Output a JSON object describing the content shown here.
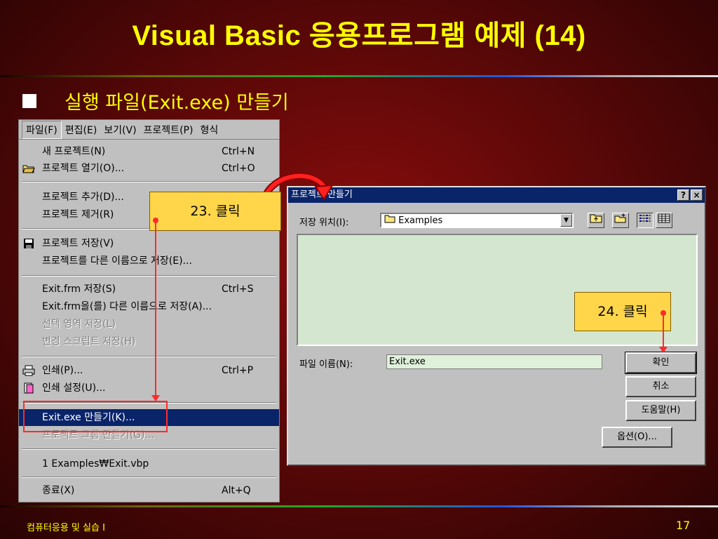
{
  "slide": {
    "title": "Visual  Basic 응용프로그램 예제 (14)",
    "bullet": "실행 파일(Exit.exe) 만들기",
    "footer_left": "컴퓨터응용 및 실습 Ⅰ",
    "page_number": "17"
  },
  "menubar": {
    "items": [
      "파일(F)",
      "편집(E)",
      "보기(V)",
      "프로젝트(P)",
      "형식"
    ]
  },
  "menu": {
    "items": [
      {
        "label": "새 프로젝트(N)",
        "shortcut": "Ctrl+N"
      },
      {
        "label": "프로젝트 열기(O)...",
        "shortcut": "Ctrl+O",
        "icon": "open-folder-icon"
      },
      {
        "label": "프로젝트 추가(D)...",
        "shortcut": ""
      },
      {
        "label": "프로젝트 제거(R)",
        "shortcut": ""
      },
      {
        "label": "프로젝트 저장(V)",
        "shortcut": "",
        "icon": "save-disk-icon"
      },
      {
        "label": "프로젝트를 다른 이름으로 저장(E)...",
        "shortcut": ""
      },
      {
        "label": "Exit.frm 저장(S)",
        "shortcut": "Ctrl+S"
      },
      {
        "label": "Exit.frm을(를) 다른 이름으로 저장(A)...",
        "shortcut": ""
      },
      {
        "label": "선택 영역 저장(L)",
        "shortcut": "",
        "disabled": true
      },
      {
        "label": "변경 스크립트 저장(H)",
        "shortcut": "",
        "disabled": true
      },
      {
        "label": "인쇄(P)...",
        "shortcut": "Ctrl+P",
        "icon": "printer-icon"
      },
      {
        "label": "인쇄 설정(U)...",
        "shortcut": "",
        "icon": "page-setup-icon"
      },
      {
        "label": "Exit.exe 만들기(K)...",
        "shortcut": "",
        "selected": true
      },
      {
        "label": "프로젝트 그룹 만들기(G)...",
        "shortcut": "",
        "disabled": true
      },
      {
        "label": "1 Examples₩Exit.vbp",
        "shortcut": ""
      },
      {
        "label": "종료(X)",
        "shortcut": "Alt+Q"
      }
    ]
  },
  "dialog": {
    "title": "프로젝트 만들기",
    "help_button": "?",
    "close_button": "×",
    "save_in_label": "저장 위치(I):",
    "save_in_value": "Examples",
    "filename_label": "파일 이름(N):",
    "filename_value": "Exit.exe",
    "ok_label": "확인",
    "cancel_label": "취소",
    "help_label": "도움말(H)",
    "options_label": "옵션(O)..."
  },
  "callouts": {
    "step23": "23. 클릭",
    "step24": "24. 클릭"
  },
  "colors": {
    "title_text": "#ffff00",
    "menu_selected": "#0a246a",
    "callout_bg": "#ffd64a",
    "marker_red": "#ff2a2a"
  }
}
